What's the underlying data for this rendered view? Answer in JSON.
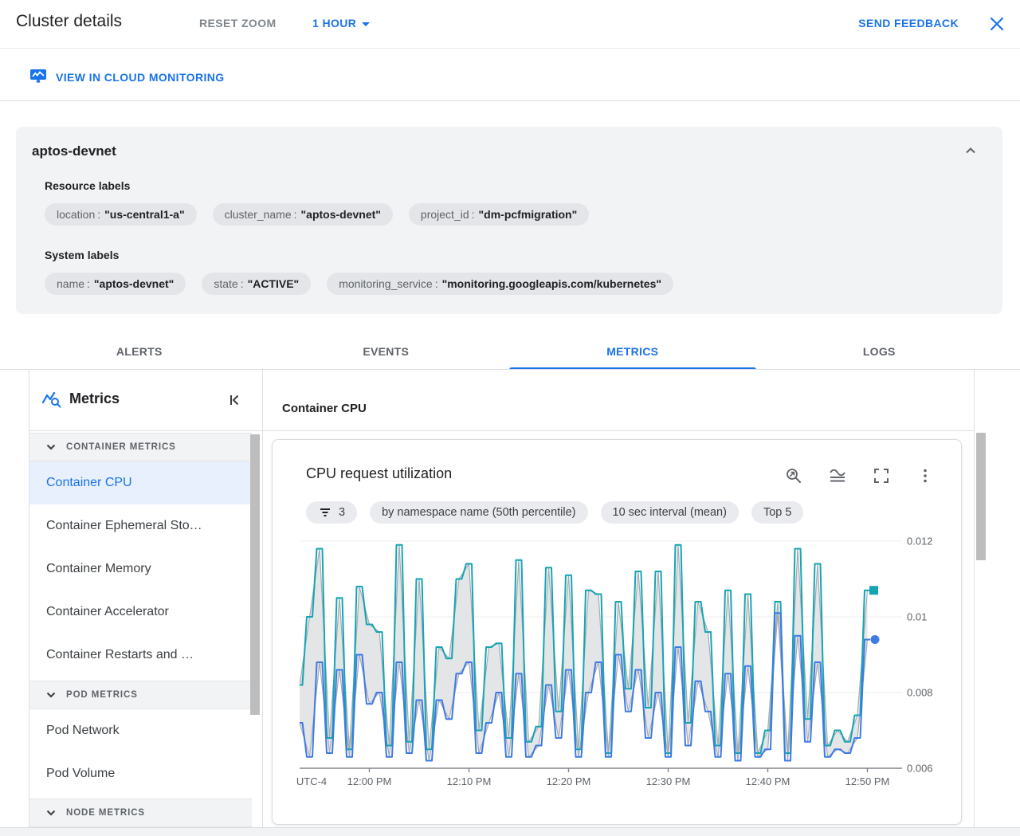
{
  "header": {
    "title": "Cluster details",
    "reset_zoom_label": "RESET ZOOM",
    "time_range_label": "1 HOUR",
    "send_feedback_label": "SEND FEEDBACK"
  },
  "link_bar": {
    "label": "VIEW IN CLOUD MONITORING"
  },
  "cluster_panel": {
    "name": "aptos-devnet",
    "separator": ":",
    "resource_labels_title": "Resource labels",
    "resource_labels": [
      {
        "key": "location",
        "value": "\"us-central1-a\""
      },
      {
        "key": "cluster_name",
        "value": "\"aptos-devnet\""
      },
      {
        "key": "project_id",
        "value": "\"dm-pcfmigration\""
      }
    ],
    "system_labels_title": "System labels",
    "system_labels": [
      {
        "key": "name",
        "value": "\"aptos-devnet\""
      },
      {
        "key": "state",
        "value": "\"ACTIVE\""
      },
      {
        "key": "monitoring_service",
        "value": "\"monitoring.googleapis.com/kubernetes\""
      }
    ]
  },
  "tabs": [
    {
      "label": "ALERTS",
      "active": false
    },
    {
      "label": "EVENTS",
      "active": false
    },
    {
      "label": "METRICS",
      "active": true
    },
    {
      "label": "LOGS",
      "active": false
    }
  ],
  "sidebar": {
    "title": "Metrics",
    "sections": [
      {
        "label": "CONTAINER METRICS",
        "items": [
          {
            "label": "Container CPU",
            "selected": true
          },
          {
            "label": "Container Ephemeral Sto…",
            "selected": false
          },
          {
            "label": "Container Memory",
            "selected": false
          },
          {
            "label": "Container Accelerator",
            "selected": false
          },
          {
            "label": "Container Restarts and …",
            "selected": false
          }
        ]
      },
      {
        "label": "POD METRICS",
        "items": [
          {
            "label": "Pod Network",
            "selected": false
          },
          {
            "label": "Pod Volume",
            "selected": false
          }
        ]
      },
      {
        "label": "NODE METRICS",
        "items": []
      }
    ]
  },
  "main": {
    "section_title": "Container CPU"
  },
  "chart_card": {
    "title": "CPU request utilization",
    "chips": [
      {
        "icon": "filter-list-icon",
        "label": "3"
      },
      {
        "label": "by namespace name (50th percentile)"
      },
      {
        "label": "10 sec interval (mean)"
      },
      {
        "label": "Top 5"
      }
    ]
  },
  "chart_data": {
    "type": "line",
    "title": "CPU request utilization",
    "x_axis_note": "UTC-4",
    "interval_minutes": 1,
    "grid": "horizontal",
    "legend": "none",
    "ylim": [
      0.006,
      0.0122
    ],
    "x_ticks": [
      {
        "t": 7,
        "label": "12:00 PM"
      },
      {
        "t": 17,
        "label": "12:10 PM"
      },
      {
        "t": 27,
        "label": "12:20 PM"
      },
      {
        "t": 37,
        "label": "12:30 PM"
      },
      {
        "t": 47,
        "label": "12:40 PM"
      },
      {
        "t": 57,
        "label": "12:50 PM"
      }
    ],
    "y_ticks": [
      {
        "v": 0.006,
        "label": "0.006"
      },
      {
        "v": 0.008,
        "label": "0.008"
      },
      {
        "v": 0.01,
        "label": "0.01"
      },
      {
        "v": 0.012,
        "label": "0.012"
      }
    ],
    "series": [
      {
        "name": "series-teal",
        "color": "#14A5B4",
        "marker": "square",
        "values": [
          0.0082,
          0.01,
          0.0118,
          0.0068,
          0.0105,
          0.0065,
          0.0108,
          0.0098,
          0.0096,
          0.0066,
          0.0119,
          0.0067,
          0.011,
          0.0065,
          0.0092,
          0.0089,
          0.011,
          0.0114,
          0.007,
          0.0092,
          0.0093,
          0.0068,
          0.0115,
          0.0067,
          0.0071,
          0.0113,
          0.0075,
          0.0111,
          0.0065,
          0.0107,
          0.0106,
          0.0064,
          0.0104,
          0.0081,
          0.0112,
          0.0076,
          0.0112,
          0.0064,
          0.0119,
          0.0072,
          0.0104,
          0.0096,
          0.0066,
          0.0107,
          0.0064,
          0.0106,
          0.0064,
          0.007,
          0.0104,
          0.0064,
          0.0118,
          0.0073,
          0.0114,
          0.0066,
          0.007,
          0.0067,
          0.0074,
          0.0107
        ]
      },
      {
        "name": "series-blue",
        "color": "#3D7AE6",
        "marker": "circle",
        "values": [
          0.0072,
          0.0063,
          0.0088,
          0.0064,
          0.0086,
          0.0063,
          0.009,
          0.0077,
          0.008,
          0.0063,
          0.0088,
          0.0064,
          0.0078,
          0.0062,
          0.0078,
          0.0073,
          0.0085,
          0.0088,
          0.0064,
          0.0072,
          0.008,
          0.0063,
          0.0085,
          0.0063,
          0.0066,
          0.0082,
          0.0068,
          0.0086,
          0.0063,
          0.008,
          0.0088,
          0.0063,
          0.009,
          0.0075,
          0.0086,
          0.0068,
          0.008,
          0.0063,
          0.0092,
          0.0066,
          0.0083,
          0.0075,
          0.0063,
          0.0085,
          0.0062,
          0.0087,
          0.0063,
          0.0065,
          0.0101,
          0.0062,
          0.0095,
          0.0067,
          0.0088,
          0.0063,
          0.0065,
          0.0064,
          0.0068,
          0.0094
        ]
      }
    ],
    "band": {
      "between": [
        "series-teal",
        "series-blue"
      ],
      "fill": "#E4E5E7",
      "stroke": "#A6ABB1"
    }
  },
  "colors": {
    "accent_blue": "#1A73E8",
    "teal_series": "#14A5B4",
    "blue_series": "#3D7AE6",
    "panel_bg": "#F1F3F4",
    "chip_bg": "#E3E5E8",
    "selected_item_bg": "#E8F0FE",
    "border": "#DADCE0",
    "text_primary": "#202124",
    "text_secondary": "#5F6368"
  }
}
